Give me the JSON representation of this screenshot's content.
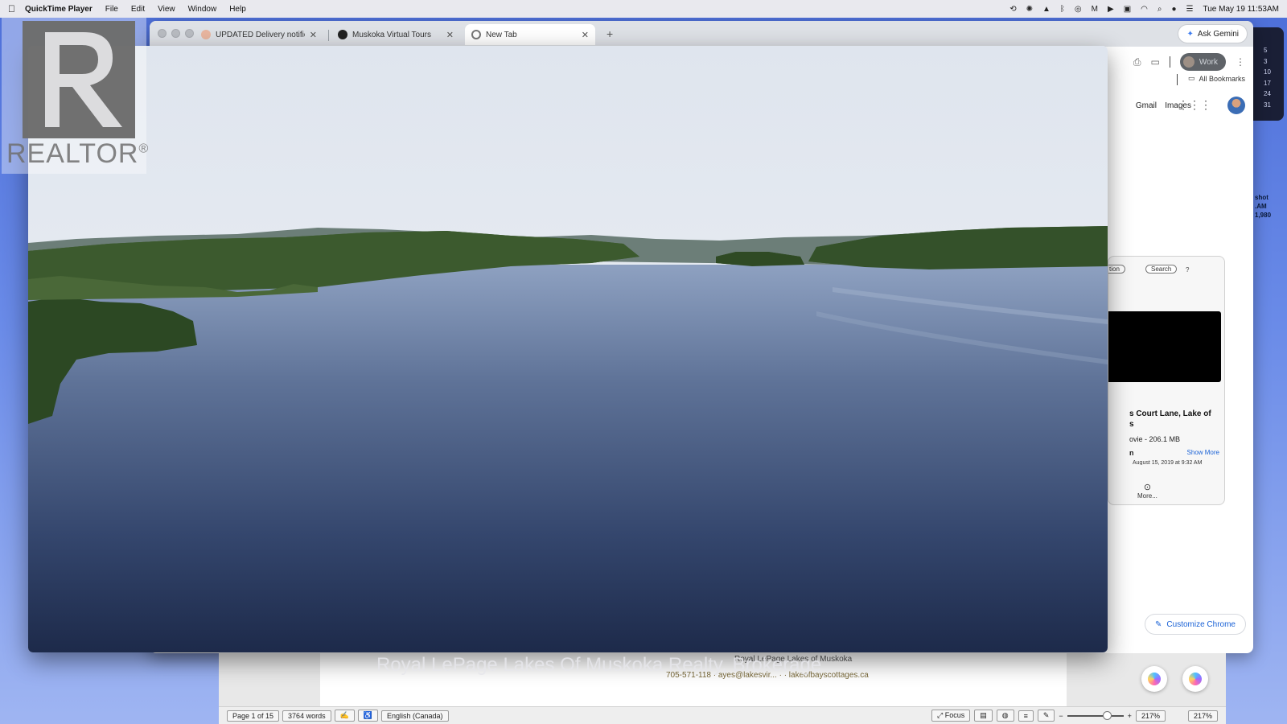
{
  "menubar": {
    "app": "QuickTime Player",
    "menus": [
      "File",
      "Edit",
      "View",
      "Window",
      "Help"
    ],
    "clock": "Tue May 19  11:53AM"
  },
  "chrome": {
    "tabs": [
      {
        "title": "UPDATED Delivery notificatio",
        "active": false
      },
      {
        "title": "Muskoka Virtual Tours",
        "active": false
      },
      {
        "title": "New Tab",
        "active": true
      }
    ],
    "ask_gemini": "Ask Gemini",
    "profile_label": "Work",
    "all_bookmarks": "All Bookmarks",
    "gmail": "Gmail",
    "images": "Images",
    "customize": "Customize Chrome"
  },
  "qt_panel": {
    "btn_left": "tion",
    "btn_search": "Search",
    "help": "?",
    "file_name_1": "s Court Lane, Lake of",
    "file_name_2": "s",
    "file_type": "ovie - 206.1 MB",
    "info_label": "n",
    "show_more": "Show More",
    "date": "August 15, 2019 at 9:32 AM",
    "more": "More..."
  },
  "side_calendar": [
    "5",
    "3",
    "10",
    "17",
    "24",
    "31"
  ],
  "side_screenshot": [
    "shot",
    ".AM",
    "1,980"
  ],
  "word": {
    "page_status": "Page 1 of 15",
    "word_count": "3764 words",
    "language": "English (Canada)",
    "focus": "Focus",
    "zoom": "217%",
    "zoom2": "217%",
    "doc_header": "Royal LePage Lakes of Muskoka",
    "doc_line": "705-571-118  · ayes@lakesvir... · · lakeofbayscottages.ca"
  },
  "overlay": {
    "realtor": "REALTOR",
    "registered": "®",
    "brokerage": "Royal LePage Lakes Of Muskoka Realty, Brokerage"
  },
  "colors": {
    "sky_top": "#dfe5ee",
    "water_deep": "#1d2a4a",
    "forest": "#3c5a2e",
    "accent_blue": "#1a62d6"
  },
  "icons": [
    "apple-icon",
    "bluetooth-icon",
    "wifi-icon",
    "search-icon",
    "control-center-icon",
    "gemini-star-icon",
    "print-icon",
    "folder-icon",
    "apps-grid-icon",
    "pencil-icon",
    "copilot-icon"
  ]
}
